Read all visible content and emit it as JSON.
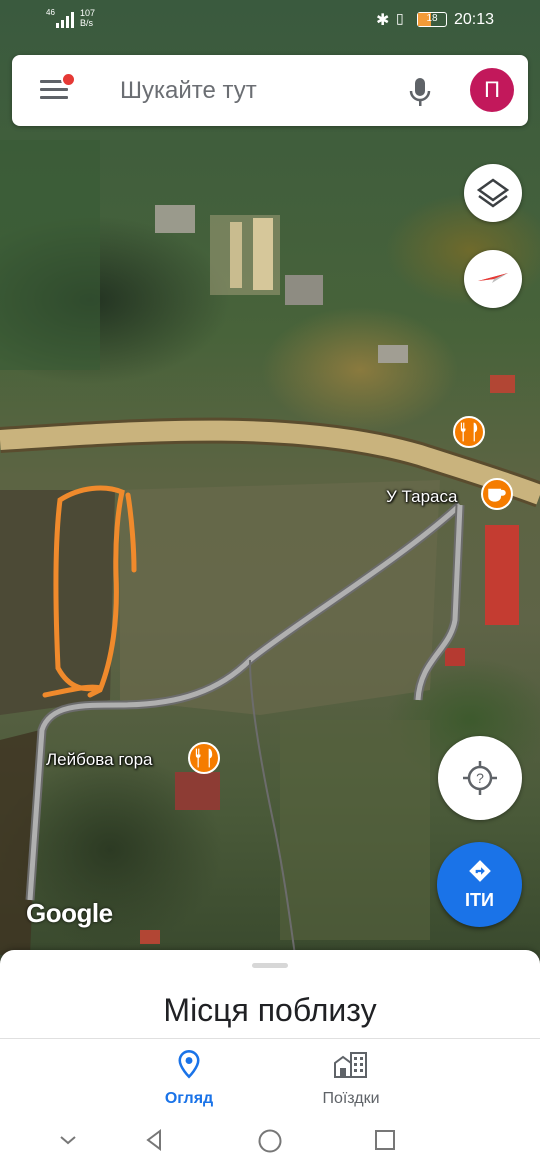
{
  "status_bar": {
    "signal": "46",
    "network_speed_value": "107",
    "network_speed_unit": "B/s",
    "battery": "18",
    "time": "20:13"
  },
  "search": {
    "placeholder": "Шукайте тут",
    "avatar_letter": "П"
  },
  "map": {
    "places": [
      {
        "name": "У Тараса"
      },
      {
        "name": "Лейбова гора"
      }
    ],
    "attribution": "Google"
  },
  "directions_button": {
    "label": "ІТИ"
  },
  "sheet": {
    "title": "Місця поблизу"
  },
  "bottom_nav": {
    "items": [
      {
        "label": "Огляд",
        "icon": "location-pin-icon",
        "active": true
      },
      {
        "label": "Поїздки",
        "icon": "commute-icon",
        "active": false
      }
    ]
  },
  "colors": {
    "accent": "#1a73e8",
    "avatar": "#c2185b",
    "poi": "#f57c00",
    "annotation": "#f08a2c"
  }
}
